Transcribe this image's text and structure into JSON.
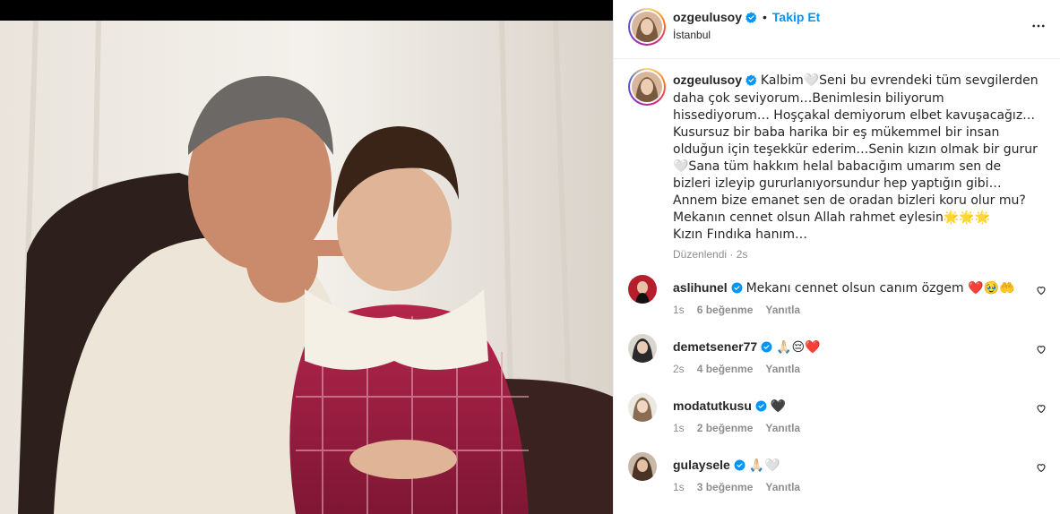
{
  "post": {
    "username": "ozgeulusoy",
    "follow_label": "Takip Et",
    "separator": "•",
    "location": "İstanbul",
    "more_icon": "more-horizontal-icon"
  },
  "caption": {
    "username": "ozgeulusoy",
    "text": "Kalbim🤍Seni bu evrendeki tüm sevgilerden daha çok seviyorum…Benimlesin biliyorum hissediyorum… Hoşçakal demiyorum elbet kavuşacağız…Kusursuz bir baba harika bir eş mükemmel bir insan olduğun için teşekkür ederim…Senin kızın olmak bir gurur🤍Sana tüm hakkım helal babacığım umarım sen de bizleri izleyip gururlanıyorsundur hep yaptığın gibi…Annem bize emanet sen de oradan bizleri koru olur mu?\nMekanın cennet olsun Allah rahmet eylesin🌟🌟🌟\nKızın Fındıka hanım…",
    "edited": "Düzenlendi",
    "dot": "·",
    "time": "2s"
  },
  "comments": [
    {
      "username": "aslihunel",
      "text": "Mekanı cennet olsun canım özgem ❤️🥹🤲",
      "time": "1s",
      "likes": "6 beğenme",
      "reply": "Yanıtla"
    },
    {
      "username": "demetsener77",
      "text": "🙏🏻😔❤️",
      "time": "2s",
      "likes": "4 beğenme",
      "reply": "Yanıtla"
    },
    {
      "username": "modatutkusu",
      "text": "🖤",
      "time": "1s",
      "likes": "2 beğenme",
      "reply": "Yanıtla"
    },
    {
      "username": "gulaysele",
      "text": "🙏🏻🤍",
      "time": "1s",
      "likes": "3 beğenme",
      "reply": "Yanıtla"
    }
  ],
  "colors": {
    "accent": "#0095f6",
    "verified": "#0095f6",
    "muted": "#8e8e8e",
    "border": "#efefef"
  }
}
